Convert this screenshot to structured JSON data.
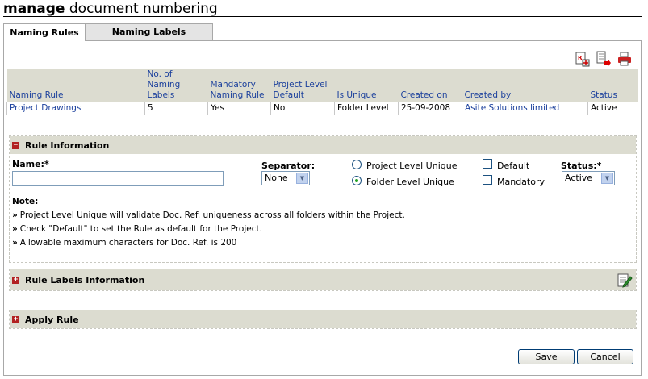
{
  "header": {
    "title_bold": "manage",
    "title_rest": "document numbering"
  },
  "tabs": [
    {
      "label": "Naming Rules",
      "active": true
    },
    {
      "label": "Naming Labels",
      "active": false
    }
  ],
  "toolbar": {
    "icons": [
      "add-rule-icon",
      "export-icon",
      "print-icon"
    ]
  },
  "rules_table": {
    "headers": [
      "Naming Rule",
      "No. of Naming Labels",
      "Mandatory Naming Rule",
      "Project Level Default",
      "Is Unique",
      "Created on",
      "Created by",
      "Status"
    ],
    "rows": [
      [
        "Project Drawings",
        "5",
        "Yes",
        "No",
        "Folder Level",
        "25-09-2008",
        "Asite Solutions limited",
        "Active"
      ]
    ]
  },
  "rule_info": {
    "heading": "Rule Information",
    "name_label": "Name:*",
    "name_value": "",
    "separator_label": "Separator:",
    "separator_value": "None",
    "unique_options": [
      {
        "label": "Project Level Unique",
        "selected": false
      },
      {
        "label": "Folder Level Unique",
        "selected": true
      }
    ],
    "default_label": "Default",
    "default_checked": false,
    "mandatory_label": "Mandatory",
    "mandatory_checked": false,
    "status_label": "Status:*",
    "status_value": "Active",
    "note_title": "Note:",
    "notes": [
      "Project Level Unique will validate Doc. Ref. uniqueness across all folders within the Project.",
      "Check \"Default\" to set the Rule as default for the Project.",
      "Allowable maximum characters for Doc. Ref. is 200"
    ],
    "note_marker": "»"
  },
  "rule_labels": {
    "heading": "Rule Labels Information"
  },
  "apply_rule": {
    "heading": "Apply Rule"
  },
  "actions": {
    "save_label": "Save",
    "cancel_label": "Cancel"
  },
  "colors": {
    "accent_blue": "#1a3f9c",
    "header_bg": "#dcdcd0",
    "toggle_red": "#b22222"
  }
}
